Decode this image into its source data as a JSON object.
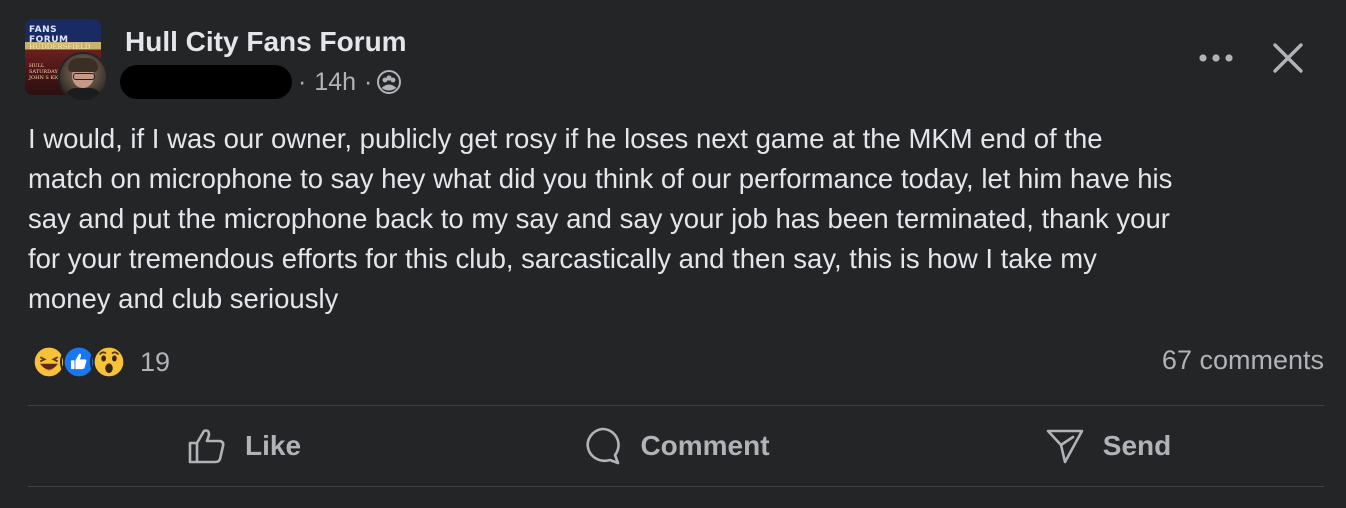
{
  "header": {
    "group_name": "Hull City Fans Forum",
    "time": "14h",
    "separator": "·",
    "audience_icon": "group-icon",
    "group_avatar_text": {
      "line1": "FANS FORUM",
      "line2": "HUDDERSFIELD",
      "line3": "HULL",
      "line4": "SATURDAY JOHN S KICK"
    },
    "more_icon": "more-horizontal-icon",
    "close_icon": "close-icon"
  },
  "post": {
    "text": "I would, if I was our owner, publicly get rosy if he loses next game at the MKM end of the\nmatch on microphone to say hey what did you think of our performance today, let him have his\nsay and put the microphone back to my say and say your job has been terminated, thank your\nfor your tremendous efforts for this club, sarcastically and then say, this is how I take my\nmoney and club seriously"
  },
  "reactions": {
    "icons": [
      "haha-emoji-icon",
      "like-emoji-icon",
      "wow-emoji-icon"
    ],
    "count": "19",
    "comments": "67 comments"
  },
  "actions": {
    "like": "Like",
    "comment": "Comment",
    "send": "Send"
  },
  "colors": {
    "background": "#242526",
    "text_primary": "#e4e6eb",
    "text_secondary": "#b0b3b8",
    "like_blue": "#1877f2",
    "emoji_yellow": "#f7c23a"
  }
}
